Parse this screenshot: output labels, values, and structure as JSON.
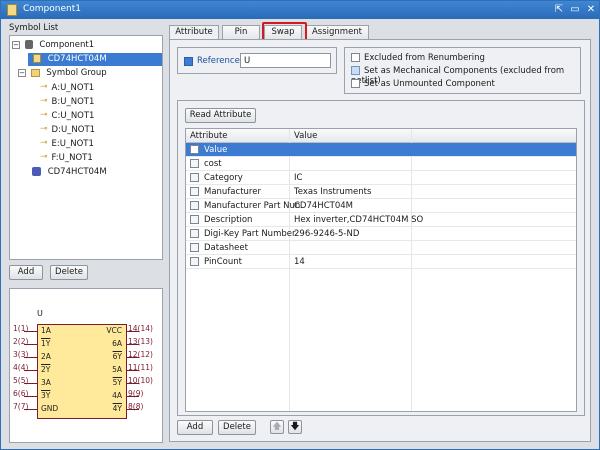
{
  "window": {
    "title": "Component1",
    "controls": [
      "pin-icon",
      "restore-icon",
      "close-icon"
    ]
  },
  "symbol_list": {
    "label": "Symbol List",
    "tree": [
      {
        "label": "Component1"
      },
      {
        "label": "CD74HCT04M"
      },
      {
        "label": "Symbol Group"
      },
      {
        "label": "A:U_NOT1"
      },
      {
        "label": "B:U_NOT1"
      },
      {
        "label": "C:U_NOT1"
      },
      {
        "label": "D:U_NOT1"
      },
      {
        "label": "E:U_NOT1"
      },
      {
        "label": "F:U_NOT1"
      },
      {
        "label": "CD74HCT04M"
      }
    ],
    "add_label": "Add",
    "delete_label": "Delete"
  },
  "preview": {
    "ref": "U",
    "left_pins": [
      "1(1)",
      "2(2)",
      "3(3)",
      "4(4)",
      "5(5)",
      "6(6)",
      "7(7)"
    ],
    "left_names": [
      "1A",
      "1Y",
      "2A",
      "2Y",
      "3A",
      "3Y",
      "GND"
    ],
    "right_names": [
      "VCC",
      "6A",
      "6Y",
      "5A",
      "5Y",
      "4A",
      "4Y"
    ],
    "right_pins": [
      "14(14)",
      "13(13)",
      "12(12)",
      "11(11)",
      "10(10)",
      "9(9)",
      "8(8)"
    ]
  },
  "tabs": [
    {
      "label": "Attribute"
    },
    {
      "label": "Pin"
    },
    {
      "label": "Swap"
    },
    {
      "label": "Assignment"
    }
  ],
  "attribute": {
    "reference_label": "Reference",
    "reference_value": "U",
    "options": [
      {
        "label": "Excluded from Renumbering"
      },
      {
        "label": "Set as Mechanical Components (excluded from netlist)"
      },
      {
        "label": "Set as Unmounted Component"
      }
    ],
    "read_attribute_label": "Read Attribute",
    "columns": [
      "Attribute",
      "Value"
    ],
    "rows": [
      {
        "attr": "Value",
        "value": ""
      },
      {
        "attr": "cost",
        "value": ""
      },
      {
        "attr": "Category",
        "value": "IC"
      },
      {
        "attr": "Manufacturer",
        "value": "Texas Instruments"
      },
      {
        "attr": "Manufacturer Part Nun",
        "value": "CD74HCT04M"
      },
      {
        "attr": "Description",
        "value": "Hex inverter,CD74HCT04M SO"
      },
      {
        "attr": "Digi-Key Part Number",
        "value": "296-9246-5-ND"
      },
      {
        "attr": "Datasheet",
        "value": ""
      },
      {
        "attr": "PinCount",
        "value": "14"
      }
    ],
    "add_label": "Add",
    "delete_label": "Delete",
    "up_glyph": "🡅",
    "down_glyph": "🡇"
  }
}
